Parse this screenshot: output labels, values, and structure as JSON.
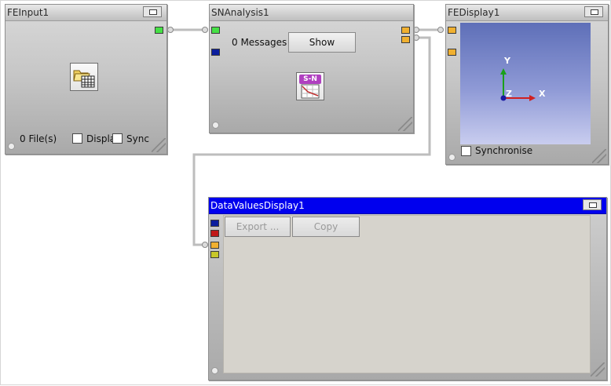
{
  "nodes": {
    "fe_input": {
      "title": "FEInput1",
      "files_label": "0 File(s)",
      "display_checkbox_label": "Display",
      "sync_checkbox_label": "Synchronise",
      "icon": "open-file-grid-icon"
    },
    "sn_analysis": {
      "title": "SNAnalysis1",
      "messages_label": "0 Messages",
      "show_button_label": "Show",
      "icon": "sn-curve-icon",
      "icon_text": "S-N"
    },
    "fe_display": {
      "title": "FEDisplay1",
      "axes": {
        "x": "X",
        "y": "Y",
        "z": "Z"
      },
      "sync_checkbox_label": "Synchronise"
    },
    "data_values_display": {
      "title": "DataValuesDisplay1",
      "export_button_label": "Export ...",
      "copy_button_label": "Copy"
    }
  },
  "port_colors": {
    "green": "#45e045",
    "blue": "#0b1e9e",
    "orange": "#f0b030",
    "red": "#c01818",
    "yellow": "#c8c82a"
  },
  "active_titlebar_color": "#0000ee"
}
